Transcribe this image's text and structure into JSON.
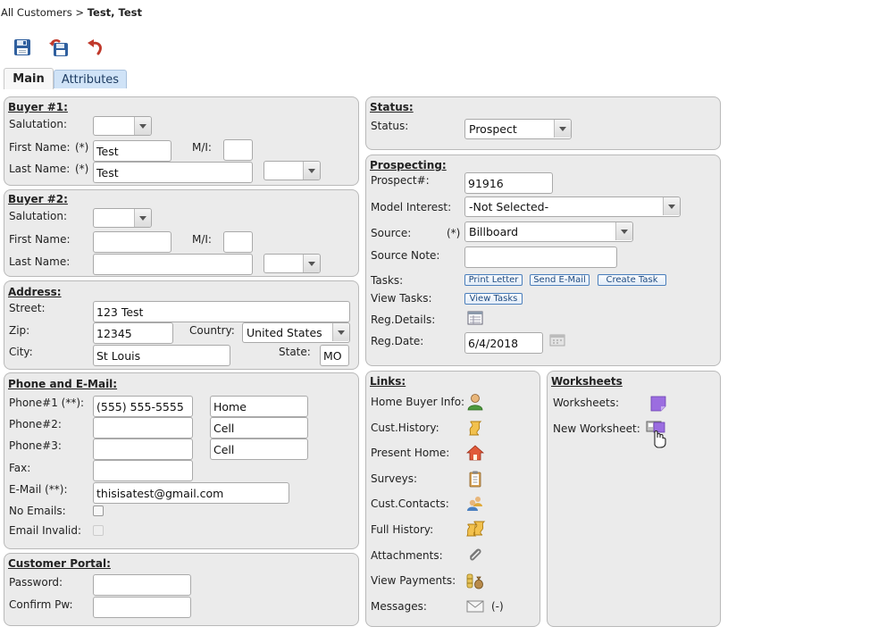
{
  "breadcrumb": {
    "root": "All Customers",
    "sep": ">",
    "current": "Test, Test"
  },
  "toolbar": {
    "icons": [
      "save-icon",
      "save-and-back-icon",
      "undo-icon"
    ]
  },
  "tabs": [
    {
      "label": "Main"
    },
    {
      "label": "Attributes"
    }
  ],
  "buyer1": {
    "title": "Buyer #1:",
    "salutation_label": "Salutation:",
    "salutation_value": "",
    "first_name_label": "First Name:",
    "required_mark": "(*)",
    "first_name": "Test",
    "mi_label": "M/I:",
    "mi": "",
    "last_name_label": "Last Name:",
    "last_name": "Test",
    "suffix_value": ""
  },
  "buyer2": {
    "title": "Buyer #2:",
    "salutation_label": "Salutation:",
    "salutation_value": "",
    "first_name_label": "First Name:",
    "first_name": "",
    "mi_label": "M/I:",
    "mi": "",
    "last_name_label": "Last Name:",
    "last_name": "",
    "suffix_value": ""
  },
  "address": {
    "title": "Address:",
    "street_label": "Street:",
    "street": "123 Test",
    "zip_label": "Zip:",
    "zip": "12345",
    "country_label": "Country:",
    "country": "United States",
    "city_label": "City:",
    "city": "St Louis",
    "state_label": "State:",
    "state": "MO"
  },
  "phone": {
    "title": "Phone and E-Mail:",
    "phone1_label": "Phone#1 (**):",
    "phone1": "(555) 555-5555",
    "phone1_type": "Home",
    "phone2_label": "Phone#2:",
    "phone2": "",
    "phone2_type": "Cell",
    "phone3_label": "Phone#3:",
    "phone3": "",
    "phone3_type": "Cell",
    "fax_label": "Fax:",
    "fax": "",
    "email_label": "E-Mail (**):",
    "email": "thisisatest@gmail.com",
    "no_emails_label": "No Emails:",
    "email_invalid_label": "Email Invalid:"
  },
  "portal": {
    "title": "Customer Portal:",
    "password_label": "Password:",
    "password": "",
    "confirm_label": "Confirm Pw:",
    "confirm": ""
  },
  "status": {
    "title": "Status:",
    "status_label": "Status:",
    "status_value": "Prospect"
  },
  "prospecting": {
    "title": "Prospecting:",
    "prospect_label": "Prospect#:",
    "prospect_value": "91916",
    "model_label": "Model Interest:",
    "model_value": "-Not Selected-",
    "source_label": "Source:",
    "required_mark": "(*)",
    "source_value": "Billboard",
    "source_note_label": "Source Note:",
    "source_note": "",
    "tasks_label": "Tasks:",
    "print_letter": "Print Letter",
    "send_email": "Send E-Mail",
    "create_task": "Create Task",
    "view_tasks_label": "View Tasks:",
    "view_tasks": "View Tasks",
    "reg_details_label": "Reg.Details:",
    "reg_date_label": "Reg.Date:",
    "reg_date": "6/4/2018"
  },
  "links": {
    "title": "Links:",
    "home_buyer_info": "Home Buyer Info:",
    "cust_history": "Cust.History:",
    "present_home": "Present Home:",
    "surveys": "Surveys:",
    "cust_contacts": "Cust.Contacts:",
    "full_history": "Full History:",
    "attachments": "Attachments:",
    "view_payments": "View Payments:",
    "messages": "Messages:",
    "messages_count": "(-)"
  },
  "worksheets": {
    "title": "Worksheets",
    "worksheets_label": "Worksheets:",
    "new_worksheet_label": "New Worksheet:"
  }
}
